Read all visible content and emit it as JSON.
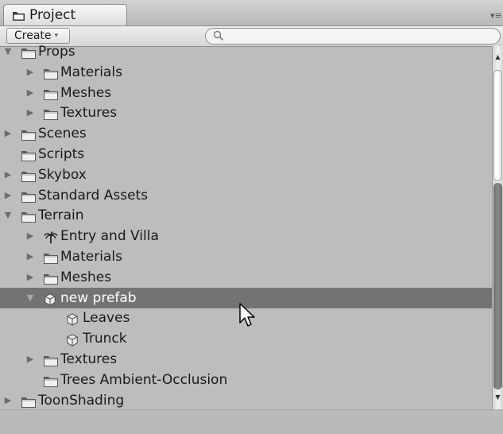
{
  "window": {
    "tab_title": "Project",
    "tab_menu_icon": "▾≡"
  },
  "toolbar": {
    "create_label": "Create",
    "create_caret": "▾",
    "search_placeholder": "",
    "search_value": ""
  },
  "tree": {
    "items": [
      {
        "label": "Props",
        "depth": 0,
        "icon": "folder-icon",
        "expander": "expanded",
        "selected": false
      },
      {
        "label": "Materials",
        "depth": 1,
        "icon": "folder-icon",
        "expander": "collapsed",
        "selected": false
      },
      {
        "label": "Meshes",
        "depth": 1,
        "icon": "folder-icon",
        "expander": "collapsed",
        "selected": false
      },
      {
        "label": "Textures",
        "depth": 1,
        "icon": "folder-icon",
        "expander": "collapsed",
        "selected": false
      },
      {
        "label": "Scenes",
        "depth": 0,
        "icon": "folder-icon",
        "expander": "collapsed",
        "selected": false
      },
      {
        "label": "Scripts",
        "depth": 0,
        "icon": "folder-icon",
        "expander": "none",
        "selected": false
      },
      {
        "label": "Skybox",
        "depth": 0,
        "icon": "folder-icon",
        "expander": "collapsed",
        "selected": false
      },
      {
        "label": "Standard Assets",
        "depth": 0,
        "icon": "folder-icon",
        "expander": "collapsed",
        "selected": false
      },
      {
        "label": "Terrain",
        "depth": 0,
        "icon": "folder-icon",
        "expander": "expanded",
        "selected": false
      },
      {
        "label": "Entry and Villa",
        "depth": 1,
        "icon": "palm-tree-icon",
        "expander": "collapsed",
        "selected": false
      },
      {
        "label": "Materials",
        "depth": 1,
        "icon": "folder-icon",
        "expander": "collapsed",
        "selected": false
      },
      {
        "label": "Meshes",
        "depth": 1,
        "icon": "folder-icon",
        "expander": "collapsed",
        "selected": false
      },
      {
        "label": "new prefab",
        "depth": 1,
        "icon": "prefab-cube-icon",
        "expander": "expanded",
        "selected": true
      },
      {
        "label": "Leaves",
        "depth": 2,
        "icon": "prefab-cube-icon",
        "expander": "none",
        "selected": false
      },
      {
        "label": "Trunck",
        "depth": 2,
        "icon": "prefab-cube-icon",
        "expander": "none",
        "selected": false
      },
      {
        "label": "Textures",
        "depth": 1,
        "icon": "folder-icon",
        "expander": "collapsed",
        "selected": false
      },
      {
        "label": "Trees Ambient-Occlusion",
        "depth": 1,
        "icon": "folder-icon",
        "expander": "none",
        "selected": false
      },
      {
        "label": "ToonShading",
        "depth": 0,
        "icon": "folder-icon",
        "expander": "collapsed",
        "selected": false
      }
    ]
  },
  "scrollbar": {
    "up_icon": "▲",
    "down_icon": "▼"
  },
  "colors": {
    "selected_row": "#737373",
    "panel_background": "#bdbdbd"
  }
}
